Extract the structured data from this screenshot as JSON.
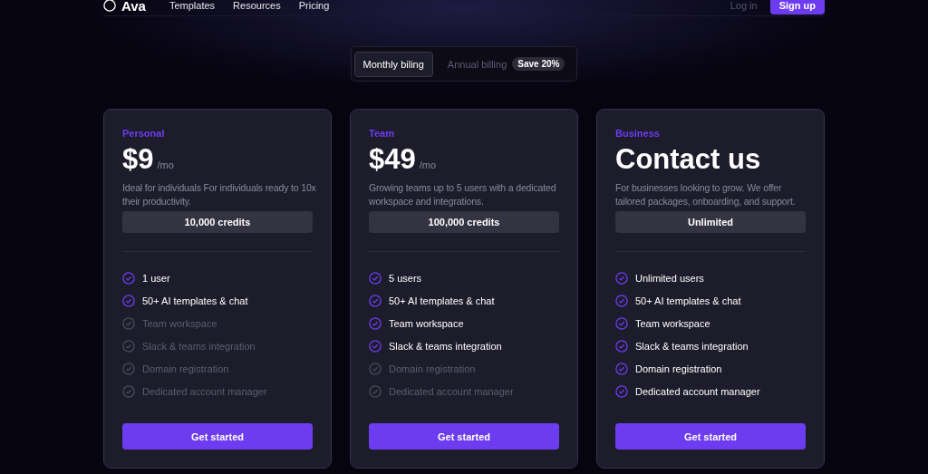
{
  "nav": {
    "brand": "Ava",
    "links": [
      "Templates",
      "Resources",
      "Pricing"
    ],
    "login": "Log in",
    "signup": "Sign up"
  },
  "billing": {
    "options": [
      {
        "label": "Monthly biling",
        "selected": true
      },
      {
        "label": "Annual billing",
        "selected": false,
        "badge": "Save 20%"
      }
    ]
  },
  "plans": [
    {
      "name": "Personal",
      "price": "$9",
      "period": "/mo",
      "description": "Ideal for individuals For individuals ready to 10x their productivity.",
      "quota": "10,000 credits",
      "features": [
        {
          "label": "1 user",
          "included": true
        },
        {
          "label": "50+ AI templates & chat",
          "included": true
        },
        {
          "label": "Team workspace",
          "included": false
        },
        {
          "label": "Slack & teams integration",
          "included": false
        },
        {
          "label": "Domain registration",
          "included": false
        },
        {
          "label": "Dedicated account manager",
          "included": false
        }
      ],
      "button": "Get started"
    },
    {
      "name": "Team",
      "price": "$49",
      "period": "/mo",
      "description": "Growing teams up to 5 users with a dedicated workspace and integrations.",
      "quota": "100,000 credits",
      "features": [
        {
          "label": "5 users",
          "included": true
        },
        {
          "label": "50+ AI templates & chat",
          "included": true
        },
        {
          "label": "Team workspace",
          "included": true
        },
        {
          "label": "Slack & teams integration",
          "included": true
        },
        {
          "label": "Domain registration",
          "included": false
        },
        {
          "label": "Dedicated account manager",
          "included": false
        }
      ],
      "button": "Get started"
    },
    {
      "name": "Business",
      "price": "Contact us",
      "description": "For businesses looking to grow. We offer tailored packages, onboarding, and support.",
      "quota": "Unlimited",
      "features": [
        {
          "label": "Unlimited users",
          "included": true
        },
        {
          "label": "50+ AI templates & chat",
          "included": true
        },
        {
          "label": "Team workspace",
          "included": true
        },
        {
          "label": "Slack & teams integration",
          "included": true
        },
        {
          "label": "Domain registration",
          "included": true
        },
        {
          "label": "Dedicated account manager",
          "included": true
        }
      ],
      "button": "Get started"
    }
  ]
}
